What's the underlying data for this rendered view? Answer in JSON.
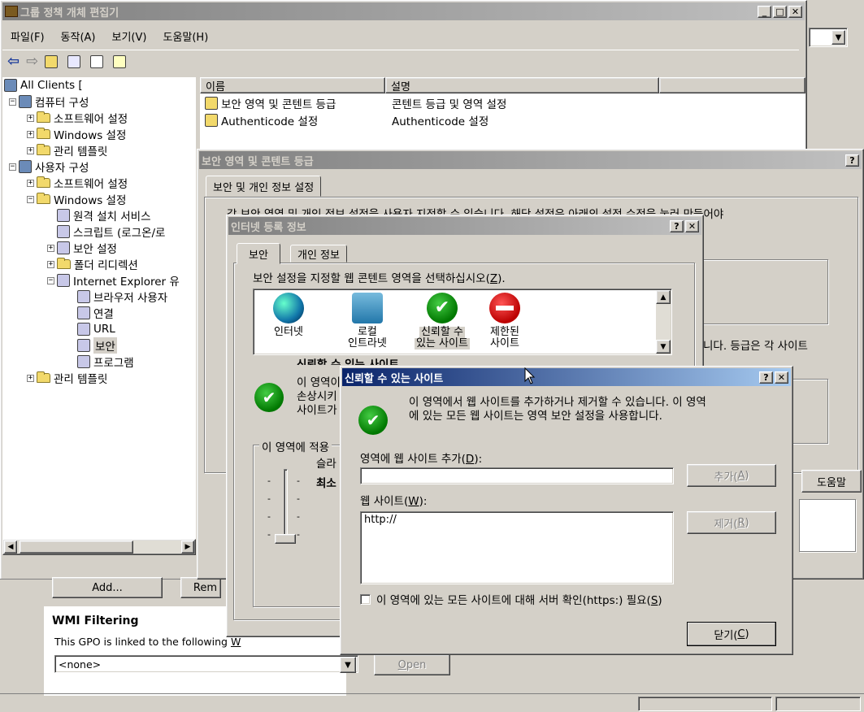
{
  "main_window": {
    "title": "그룹 정책 개체 편집기",
    "menu": [
      "파일(F)",
      "동작(A)",
      "보기(V)",
      "도움말(H)"
    ],
    "tree": [
      {
        "label": "All Clients [",
        "level": 0
      },
      {
        "label": "컴퓨터 구성",
        "level": 1
      },
      {
        "label": "소프트웨어 설정",
        "level": 2
      },
      {
        "label": "Windows 설정",
        "level": 2
      },
      {
        "label": "관리 템플릿",
        "level": 2
      },
      {
        "label": "사용자 구성",
        "level": 1
      },
      {
        "label": "소프트웨어 설정",
        "level": 2
      },
      {
        "label": "Windows 설정",
        "level": 2
      },
      {
        "label": "원격 설치 서비스",
        "level": 3
      },
      {
        "label": "스크립트 (로그온/로",
        "level": 3
      },
      {
        "label": "보안 설정",
        "level": 3
      },
      {
        "label": "폴더 리디렉션",
        "level": 3
      },
      {
        "label": "Internet Explorer 유",
        "level": 3
      },
      {
        "label": "브라우저 사용자",
        "level": 4
      },
      {
        "label": "연결",
        "level": 4
      },
      {
        "label": "URL",
        "level": 4
      },
      {
        "label": "보안",
        "level": 4
      },
      {
        "label": "프로그램",
        "level": 4
      },
      {
        "label": "관리 템플릿",
        "level": 2
      }
    ],
    "list_headers": {
      "name": "이름",
      "desc": "설명"
    },
    "list_rows": [
      {
        "name": "보안 영역 및 콘텐트 등급",
        "desc": "콘텐트 등급 및 영역 설정"
      },
      {
        "name": "Authenticode 설정",
        "desc": "Authenticode 설정"
      }
    ]
  },
  "background_props": {
    "add_button": "Add...",
    "remove_button": "Rem",
    "wmi_title": "WMI Filtering",
    "wmi_text": "This GPO is linked to the following ",
    "wmi_text_u": "W",
    "wmi_select": "<none>",
    "open_button": "Open",
    "open_mn": "O",
    "open_rest": "pen",
    "help_button": "도움말"
  },
  "zone_rating_dialog": {
    "title": "보안 영역 및 콘텐트 등급",
    "tab": "보안 및 개인 정보 설정",
    "desc": "각 보안 영역 및 개인 정보 설정을 사용자 지정할 수 있습니다. 해당 설정은 아래의 설정 수정을 눌러 만들어야",
    "desc2": "니다. 등급은 각 사이트"
  },
  "internet_props": {
    "title": "인터넷 등록 정보",
    "tabs": [
      "보안",
      "개인 정보"
    ],
    "instruction": "보안 설정을 지정할 웹 콘텐트 영역을 선택하십시오(",
    "instruction_mn": "Z",
    "instruction_end": ").",
    "zones": [
      {
        "label1": "인터넷",
        "label2": ""
      },
      {
        "label1": "로컬",
        "label2": "인트라넷"
      },
      {
        "label1": "신뢰할 수",
        "label2": "있는 사이트"
      },
      {
        "label1": "제한된",
        "label2": "사이트"
      }
    ],
    "zone_heading": "신뢰할 수 있는 사이트",
    "zone_desc": [
      "이 영역이",
      "손상시키",
      "사이트가"
    ],
    "group_label": "이 영역에 적용",
    "slider_label": "슬라",
    "level": "최소"
  },
  "trusted_sites": {
    "title": "신뢰할 수 있는 사이트",
    "desc_line1": "이 영역에서 웹 사이트를 추가하거나 제거할 수 있습니다. 이 영역",
    "desc_line2": "에 있는 모든 웹 사이트는 영역 보안 설정을 사용합니다.",
    "add_label_pre": "영역에 웹 사이트 추가(",
    "add_label_mn": "D",
    "add_label_end": "):",
    "add_input_value": "",
    "add_button_pre": "추가(",
    "add_button_mn": "A",
    "add_button_end": ")",
    "sites_label_pre": "웹 사이트(",
    "sites_label_mn": "W",
    "sites_label_end": "):",
    "sites": [
      "http://"
    ],
    "remove_button_pre": "제거(",
    "remove_button_mn": "R",
    "remove_button_end": ")",
    "https_label_pre": "이 영역에 있는 모든 사이트에 대해 서버 확인(https:) 필요(",
    "https_label_mn": "S",
    "https_label_end": ")",
    "close_button_pre": "닫기(",
    "close_button_mn": "C",
    "close_button_end": ")"
  },
  "colors": {
    "active_title": "#0a246a",
    "inactive_title": "#808080",
    "face": "#d4d0c8"
  }
}
